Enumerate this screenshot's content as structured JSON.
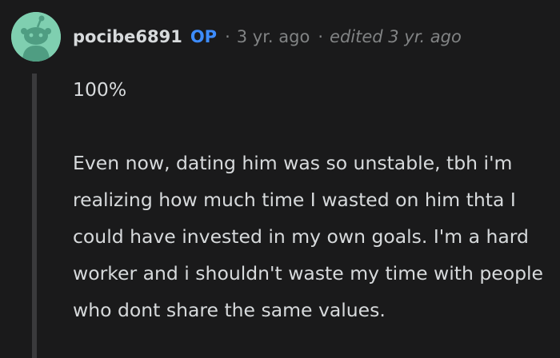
{
  "comment": {
    "author": {
      "username": "pocibe6891",
      "badge": "OP",
      "avatar_icon": "snoo-avatar-icon",
      "avatar_color": "#7fcfb0"
    },
    "separator": "·",
    "age": "3 yr. ago",
    "edited": "edited 3 yr. ago",
    "body": {
      "paragraph_1": "100%",
      "paragraph_2": "Even now, dating him was so unstable, tbh i'm realizing how much time I wasted on him thta I could have invested in my own goals. I'm a hard worker and i shouldn't waste my time with people who dont share the same values."
    }
  },
  "colors": {
    "background": "#1a1a1b",
    "text": "#d7dadc",
    "muted": "#818384",
    "op_badge": "#3d8cff",
    "thread_line": "#3a3a3c"
  }
}
